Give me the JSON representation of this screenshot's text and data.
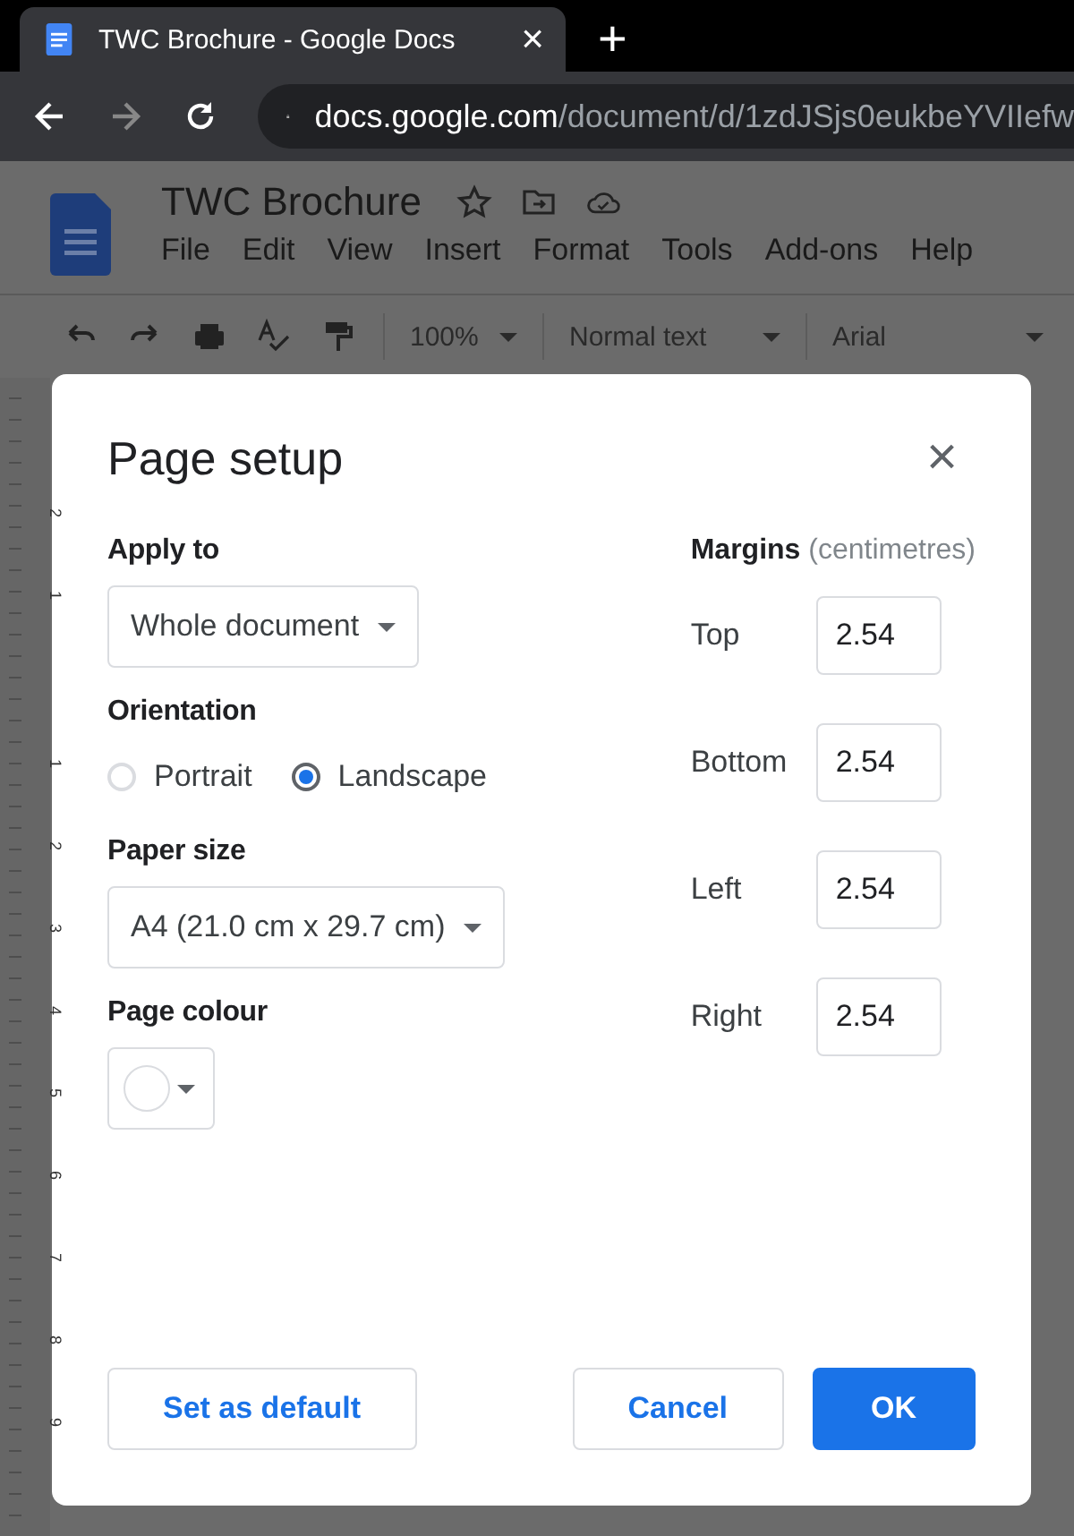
{
  "browser": {
    "tab_title": "TWC Brochure - Google Docs",
    "tab_close": "×",
    "new_tab": "+",
    "url_host": "docs.google.com",
    "url_path": "/document/d/1zdJSjs0eukbeYVIIefw"
  },
  "doc": {
    "title": "TWC Brochure",
    "menu": [
      "File",
      "Edit",
      "View",
      "Insert",
      "Format",
      "Tools",
      "Add-ons",
      "Help"
    ],
    "zoom": "100%",
    "style": "Normal text",
    "font": "Arial",
    "ruler_labels": [
      "2",
      "1",
      "1",
      "2",
      "3",
      "4",
      "5",
      "6",
      "7",
      "8",
      "9"
    ]
  },
  "dialog": {
    "title": "Page setup",
    "close": "×",
    "apply_to": {
      "label": "Apply to",
      "value": "Whole document"
    },
    "orientation": {
      "label": "Orientation",
      "options": [
        {
          "label": "Portrait",
          "selected": false
        },
        {
          "label": "Landscape",
          "selected": true
        }
      ]
    },
    "paper_size": {
      "label": "Paper size",
      "value": "A4 (21.0 cm x 29.7 cm)"
    },
    "page_colour": {
      "label": "Page colour",
      "color": "#ffffff"
    },
    "margins": {
      "label": "Margins",
      "unit": "(centimetres)",
      "fields": [
        {
          "label": "Top",
          "value": "2.54"
        },
        {
          "label": "Bottom",
          "value": "2.54"
        },
        {
          "label": "Left",
          "value": "2.54"
        },
        {
          "label": "Right",
          "value": "2.54"
        }
      ]
    },
    "buttons": {
      "default": "Set as default",
      "cancel": "Cancel",
      "ok": "OK"
    }
  }
}
